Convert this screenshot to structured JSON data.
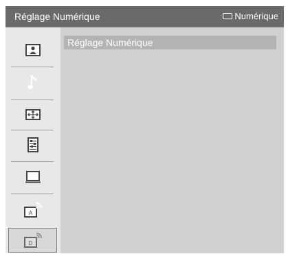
{
  "header": {
    "title": "Réglage Numérique",
    "source_label": "Numérique",
    "source_icon": "tv-box-icon"
  },
  "sidebar": {
    "items": [
      {
        "icon": "picture-icon"
      },
      {
        "icon": "music-note-icon"
      },
      {
        "icon": "screen-adjust-icon"
      },
      {
        "icon": "settings-list-icon"
      },
      {
        "icon": "pc-monitor-icon"
      },
      {
        "icon": "analog-tuning-icon",
        "letter": "A"
      },
      {
        "icon": "digital-tuning-icon",
        "letter": "D",
        "active": true
      }
    ]
  },
  "main": {
    "selected_item": "Réglage Numérique"
  },
  "colors": {
    "header_bg": "#6a6a6a",
    "sidebar_bg": "#e8e8e8",
    "content_bg": "#d0d0d0",
    "highlight_bg": "#b3b3b3"
  }
}
